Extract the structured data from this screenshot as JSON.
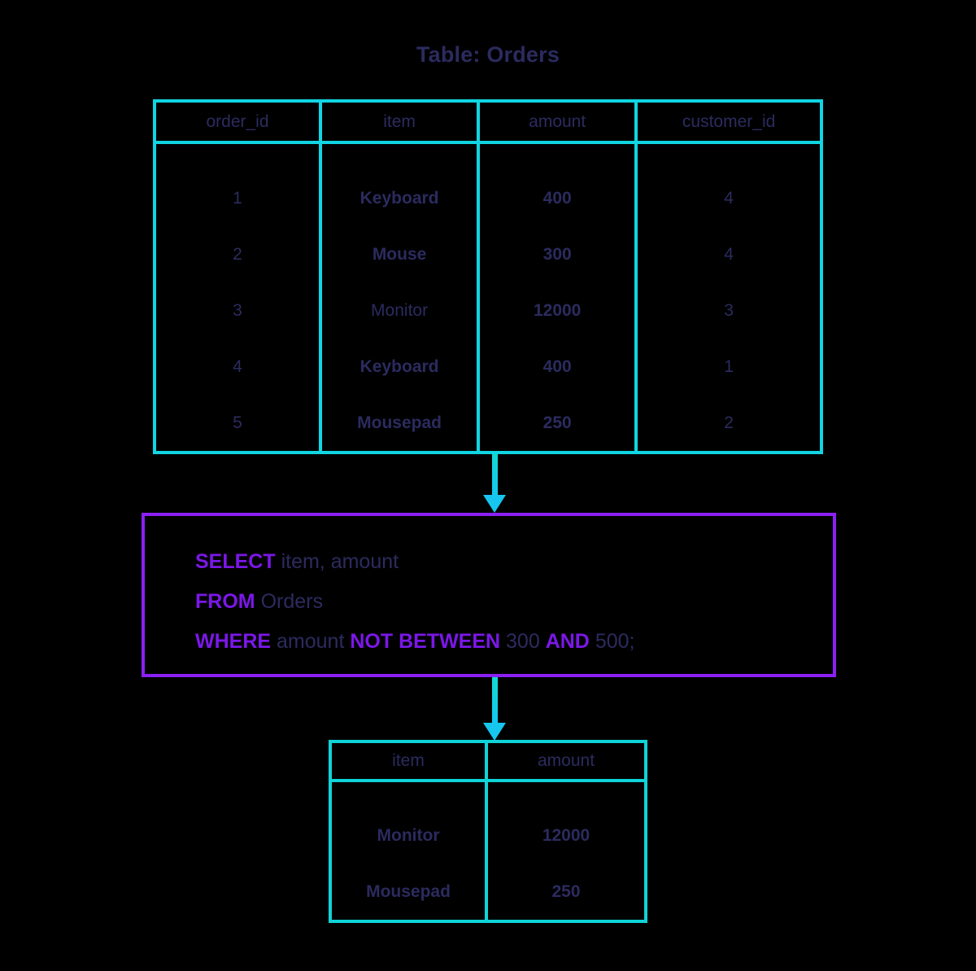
{
  "diagram": {
    "title": "Table: Orders"
  },
  "source_table": {
    "name": "Orders",
    "columns": [
      "order_id",
      "item",
      "amount",
      "customer_id"
    ],
    "rows": [
      {
        "order_id": "1",
        "item": "Keyboard",
        "amount": "400",
        "customer_id": "4"
      },
      {
        "order_id": "2",
        "item": "Mouse",
        "amount": "300",
        "customer_id": "4"
      },
      {
        "order_id": "3",
        "item": "Monitor",
        "amount": "12000",
        "customer_id": "3"
      },
      {
        "order_id": "4",
        "item": "Keyboard",
        "amount": "400",
        "customer_id": "1"
      },
      {
        "order_id": "5",
        "item": "Mousepad",
        "amount": "250",
        "customer_id": "2"
      }
    ]
  },
  "query": {
    "line1": {
      "keyword": "SELECT",
      "rest": "item, amount"
    },
    "line2": {
      "keyword": "FROM",
      "rest": "Orders"
    },
    "line3": {
      "keyword": "WHERE",
      "column": "amount",
      "operator": "NOT BETWEEN",
      "low": "300",
      "conjunction": "AND",
      "high": "500;"
    },
    "full_text": "SELECT item, amount FROM Orders WHERE amount NOT BETWEEN 300 AND 500;"
  },
  "result_table": {
    "columns": [
      "item",
      "amount"
    ],
    "rows": [
      {
        "item": "Monitor",
        "amount": "12000"
      },
      {
        "item": "Mousepad",
        "amount": "250"
      }
    ]
  },
  "colors": {
    "background": "#000000",
    "table_border": "#10D5E2",
    "result_border": "#0FD3D8",
    "query_border": "#8B20F5",
    "keyword": "#7B17E8",
    "text": "#2B2B5F",
    "arrow": "#16C6EE"
  }
}
